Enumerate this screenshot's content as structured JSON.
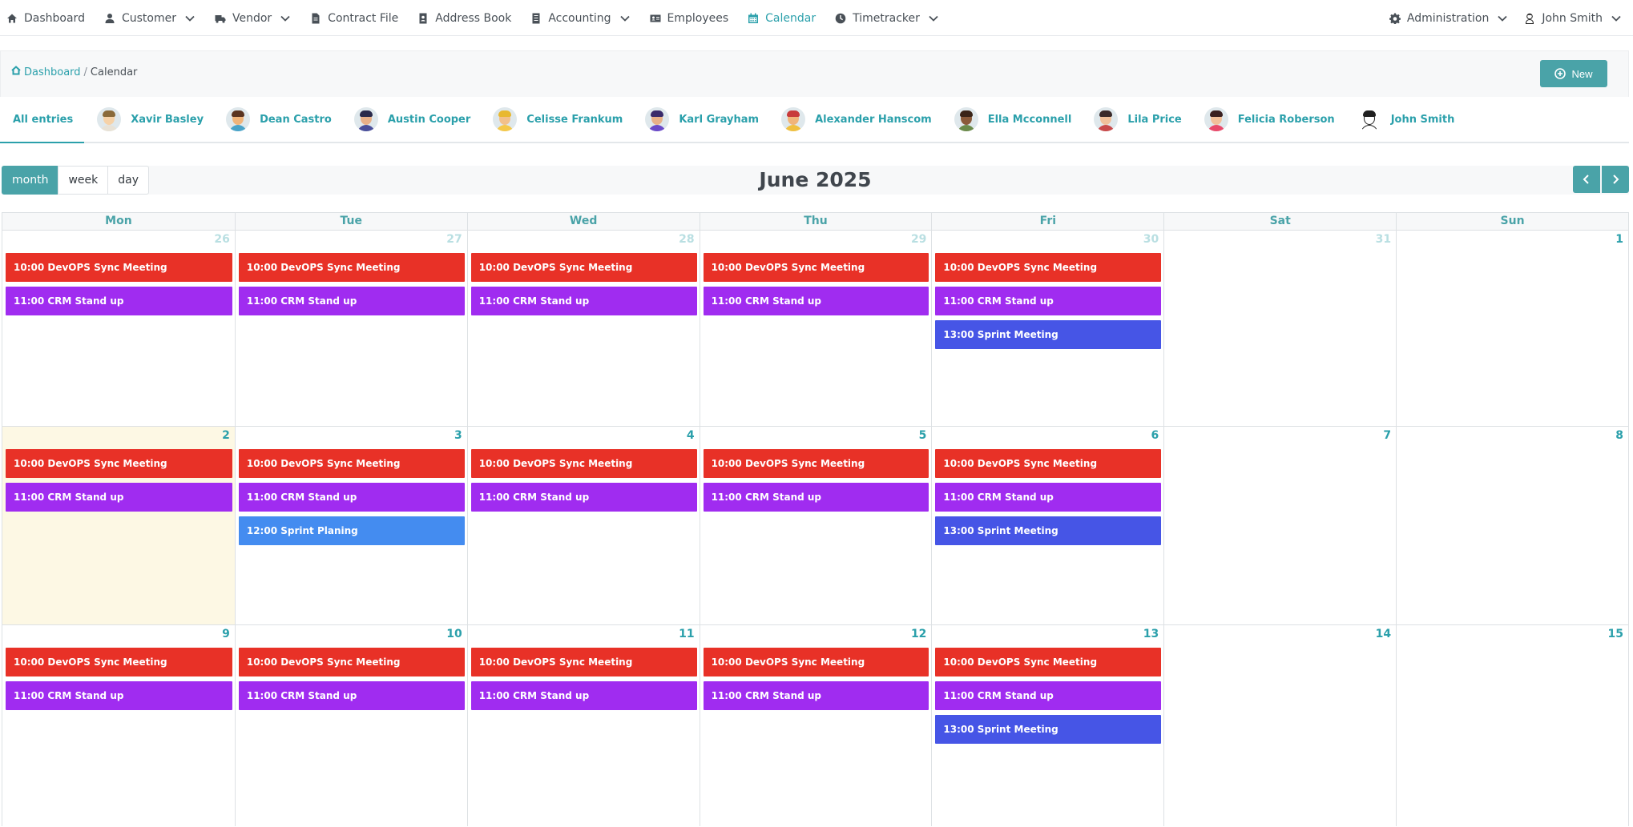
{
  "nav": {
    "left": [
      {
        "label": "Dashboard",
        "icon": "home-icon",
        "dropdown": false,
        "active": false
      },
      {
        "label": "Customer",
        "icon": "user-icon",
        "dropdown": true,
        "active": false
      },
      {
        "label": "Vendor",
        "icon": "truck-icon",
        "dropdown": true,
        "active": false
      },
      {
        "label": "Contract File",
        "icon": "file-icon",
        "dropdown": false,
        "active": false
      },
      {
        "label": "Address Book",
        "icon": "address-book-icon",
        "dropdown": false,
        "active": false
      },
      {
        "label": "Accounting",
        "icon": "ledger-icon",
        "dropdown": true,
        "active": false
      },
      {
        "label": "Employees",
        "icon": "id-card-icon",
        "dropdown": false,
        "active": false
      },
      {
        "label": "Calendar",
        "icon": "calendar-icon",
        "dropdown": false,
        "active": true
      },
      {
        "label": "Timetracker",
        "icon": "clock-icon",
        "dropdown": true,
        "active": false
      }
    ],
    "right": [
      {
        "label": "Administration",
        "icon": "gear-icon",
        "dropdown": true
      },
      {
        "label": "John Smith",
        "icon": "user-avatar-icon",
        "dropdown": true
      }
    ]
  },
  "breadcrumb": {
    "home": "Dashboard",
    "separator": "/",
    "current": "Calendar"
  },
  "new_button": "New",
  "user_tabs": [
    {
      "label": "All entries",
      "active": true
    },
    {
      "label": "Xavir Basley",
      "skin": "#f6d2a8",
      "hair": "#8a6a3a",
      "shirt": "#e8e2d6"
    },
    {
      "label": "Dean Castro",
      "skin": "#f0b47a",
      "hair": "#5a3420",
      "shirt": "#4aa3c8"
    },
    {
      "label": "Austin Cooper",
      "skin": "#e8b088",
      "hair": "#2b2a4a",
      "shirt": "#4a4f9a"
    },
    {
      "label": "Celisse Frankum",
      "skin": "#f2c08a",
      "hair": "#e8b830",
      "shirt": "#f4c84a"
    },
    {
      "label": "Karl Grayham",
      "skin": "#e8b088",
      "hair": "#3a2a6a",
      "shirt": "#6a4ac8"
    },
    {
      "label": "Alexander Hanscom",
      "skin": "#f0b47a",
      "hair": "#c83a3a",
      "shirt": "#f0c040"
    },
    {
      "label": "Ella Mcconnell",
      "skin": "#8a5a3a",
      "hair": "#3a2418",
      "shirt": "#6a8a4a"
    },
    {
      "label": "Lila Price",
      "skin": "#f0c09a",
      "hair": "#3a2a2a",
      "shirt": "#c84a4a"
    },
    {
      "label": "Felicia Roberson",
      "skin": "#f2c09a",
      "hair": "#3a2020",
      "shirt": "#e84a6a"
    },
    {
      "label": "John Smith",
      "skin": "#ffffff",
      "hair": "#202020",
      "shirt": "#ffffff"
    }
  ],
  "views": [
    {
      "label": "month",
      "active": true
    },
    {
      "label": "week",
      "active": false
    },
    {
      "label": "day",
      "active": false
    }
  ],
  "calendar_title": "June 2025",
  "weekdays": [
    "Mon",
    "Tue",
    "Wed",
    "Thu",
    "Fri",
    "Sat",
    "Sun"
  ],
  "colors": {
    "accent": "#2ba0ab",
    "devops": "#e83127",
    "standup": "#a02cf0",
    "sprint_meeting": "#4655e6",
    "sprint_planing": "#448cf0",
    "today_bg": "#fdf8e4"
  },
  "weeks": [
    {
      "days": [
        {
          "num": "26",
          "other": true,
          "events": [
            {
              "text": "10:00 DevOPS Sync Meeting",
              "type": "devops"
            },
            {
              "text": "11:00 CRM Stand up",
              "type": "standup"
            }
          ]
        },
        {
          "num": "27",
          "other": true,
          "events": [
            {
              "text": "10:00 DevOPS Sync Meeting",
              "type": "devops"
            },
            {
              "text": "11:00 CRM Stand up",
              "type": "standup"
            }
          ]
        },
        {
          "num": "28",
          "other": true,
          "events": [
            {
              "text": "10:00 DevOPS Sync Meeting",
              "type": "devops"
            },
            {
              "text": "11:00 CRM Stand up",
              "type": "standup"
            }
          ]
        },
        {
          "num": "29",
          "other": true,
          "events": [
            {
              "text": "10:00 DevOPS Sync Meeting",
              "type": "devops"
            },
            {
              "text": "11:00 CRM Stand up",
              "type": "standup"
            }
          ]
        },
        {
          "num": "30",
          "other": true,
          "events": [
            {
              "text": "10:00 DevOPS Sync Meeting",
              "type": "devops"
            },
            {
              "text": "11:00 CRM Stand up",
              "type": "standup"
            },
            {
              "text": "13:00 Sprint Meeting",
              "type": "sprint_meeting"
            }
          ]
        },
        {
          "num": "31",
          "other": true,
          "events": []
        },
        {
          "num": "1",
          "other": false,
          "events": []
        }
      ]
    },
    {
      "days": [
        {
          "num": "2",
          "other": false,
          "today": true,
          "events": [
            {
              "text": "10:00 DevOPS Sync Meeting",
              "type": "devops"
            },
            {
              "text": "11:00 CRM Stand up",
              "type": "standup"
            }
          ]
        },
        {
          "num": "3",
          "other": false,
          "events": [
            {
              "text": "10:00 DevOPS Sync Meeting",
              "type": "devops"
            },
            {
              "text": "11:00 CRM Stand up",
              "type": "standup"
            },
            {
              "text": "12:00 Sprint Planing",
              "type": "sprint_planing"
            }
          ]
        },
        {
          "num": "4",
          "other": false,
          "events": [
            {
              "text": "10:00 DevOPS Sync Meeting",
              "type": "devops"
            },
            {
              "text": "11:00 CRM Stand up",
              "type": "standup"
            }
          ]
        },
        {
          "num": "5",
          "other": false,
          "events": [
            {
              "text": "10:00 DevOPS Sync Meeting",
              "type": "devops"
            },
            {
              "text": "11:00 CRM Stand up",
              "type": "standup"
            }
          ]
        },
        {
          "num": "6",
          "other": false,
          "events": [
            {
              "text": "10:00 DevOPS Sync Meeting",
              "type": "devops"
            },
            {
              "text": "11:00 CRM Stand up",
              "type": "standup"
            },
            {
              "text": "13:00 Sprint Meeting",
              "type": "sprint_meeting"
            }
          ]
        },
        {
          "num": "7",
          "other": false,
          "events": []
        },
        {
          "num": "8",
          "other": false,
          "events": []
        }
      ]
    },
    {
      "days": [
        {
          "num": "9",
          "other": false,
          "events": [
            {
              "text": "10:00 DevOPS Sync Meeting",
              "type": "devops"
            },
            {
              "text": "11:00 CRM Stand up",
              "type": "standup"
            }
          ]
        },
        {
          "num": "10",
          "other": false,
          "events": [
            {
              "text": "10:00 DevOPS Sync Meeting",
              "type": "devops"
            },
            {
              "text": "11:00 CRM Stand up",
              "type": "standup"
            }
          ]
        },
        {
          "num": "11",
          "other": false,
          "events": [
            {
              "text": "10:00 DevOPS Sync Meeting",
              "type": "devops"
            },
            {
              "text": "11:00 CRM Stand up",
              "type": "standup"
            }
          ]
        },
        {
          "num": "12",
          "other": false,
          "events": [
            {
              "text": "10:00 DevOPS Sync Meeting",
              "type": "devops"
            },
            {
              "text": "11:00 CRM Stand up",
              "type": "standup"
            }
          ]
        },
        {
          "num": "13",
          "other": false,
          "events": [
            {
              "text": "10:00 DevOPS Sync Meeting",
              "type": "devops"
            },
            {
              "text": "11:00 CRM Stand up",
              "type": "standup"
            },
            {
              "text": "13:00 Sprint Meeting",
              "type": "sprint_meeting"
            }
          ]
        },
        {
          "num": "14",
          "other": false,
          "events": []
        },
        {
          "num": "15",
          "other": false,
          "events": []
        }
      ]
    }
  ]
}
